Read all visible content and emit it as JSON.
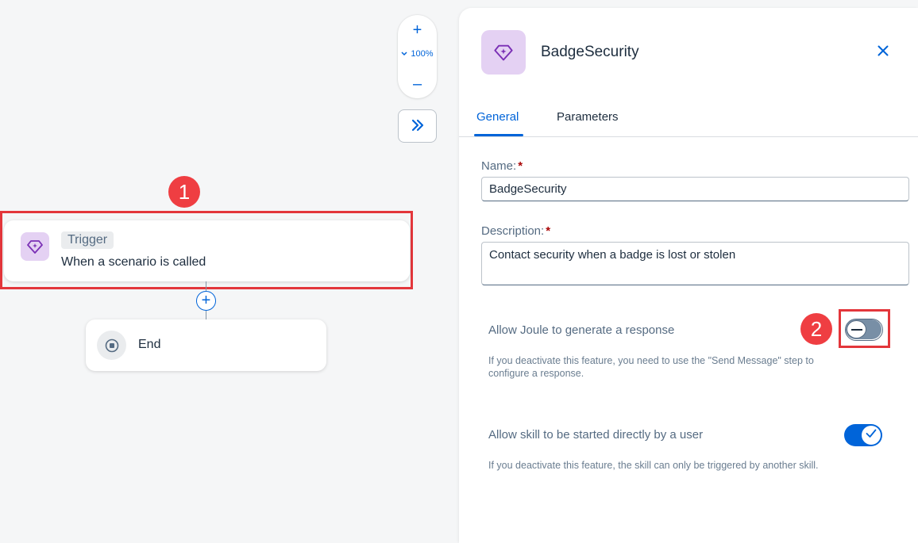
{
  "canvas": {
    "zoom": {
      "in_symbol": "+",
      "level": "100%",
      "out_symbol": "–"
    },
    "expand_symbol": "»",
    "trigger": {
      "tag": "Trigger",
      "text": "When a scenario is called"
    },
    "add_symbol": "+",
    "end": {
      "label": "End"
    }
  },
  "callouts": {
    "first": "1",
    "second": "2"
  },
  "panel": {
    "title": "BadgeSecurity",
    "tabs": [
      "General",
      "Parameters"
    ],
    "active_tab": "General",
    "name_label": "Name:",
    "name_value": "BadgeSecurity",
    "description_label": "Description:",
    "description_value": "Contact security when a badge is lost or stolen",
    "required_marker": "*",
    "joule_option": {
      "label": "Allow Joule to generate a response",
      "help": "If you deactivate this feature, you need to use the \"Send Message\" step to configure a response.",
      "enabled": false
    },
    "user_start_option": {
      "label": "Allow skill to be started directly by a user",
      "help": "If you deactivate this feature, the skill can only be triggered by another skill.",
      "enabled": true
    }
  },
  "colors": {
    "accent": "#0064d9",
    "callout": "#ef3e42",
    "icon_bg": "#e4d1f3",
    "icon_fg": "#7a2fb5"
  },
  "icons": {
    "trigger": "diamond-sparkle-icon",
    "end": "stop-icon",
    "close": "close-icon",
    "expand": "double-chevron-right-icon",
    "zoom_chevron": "chevron-down-icon"
  }
}
